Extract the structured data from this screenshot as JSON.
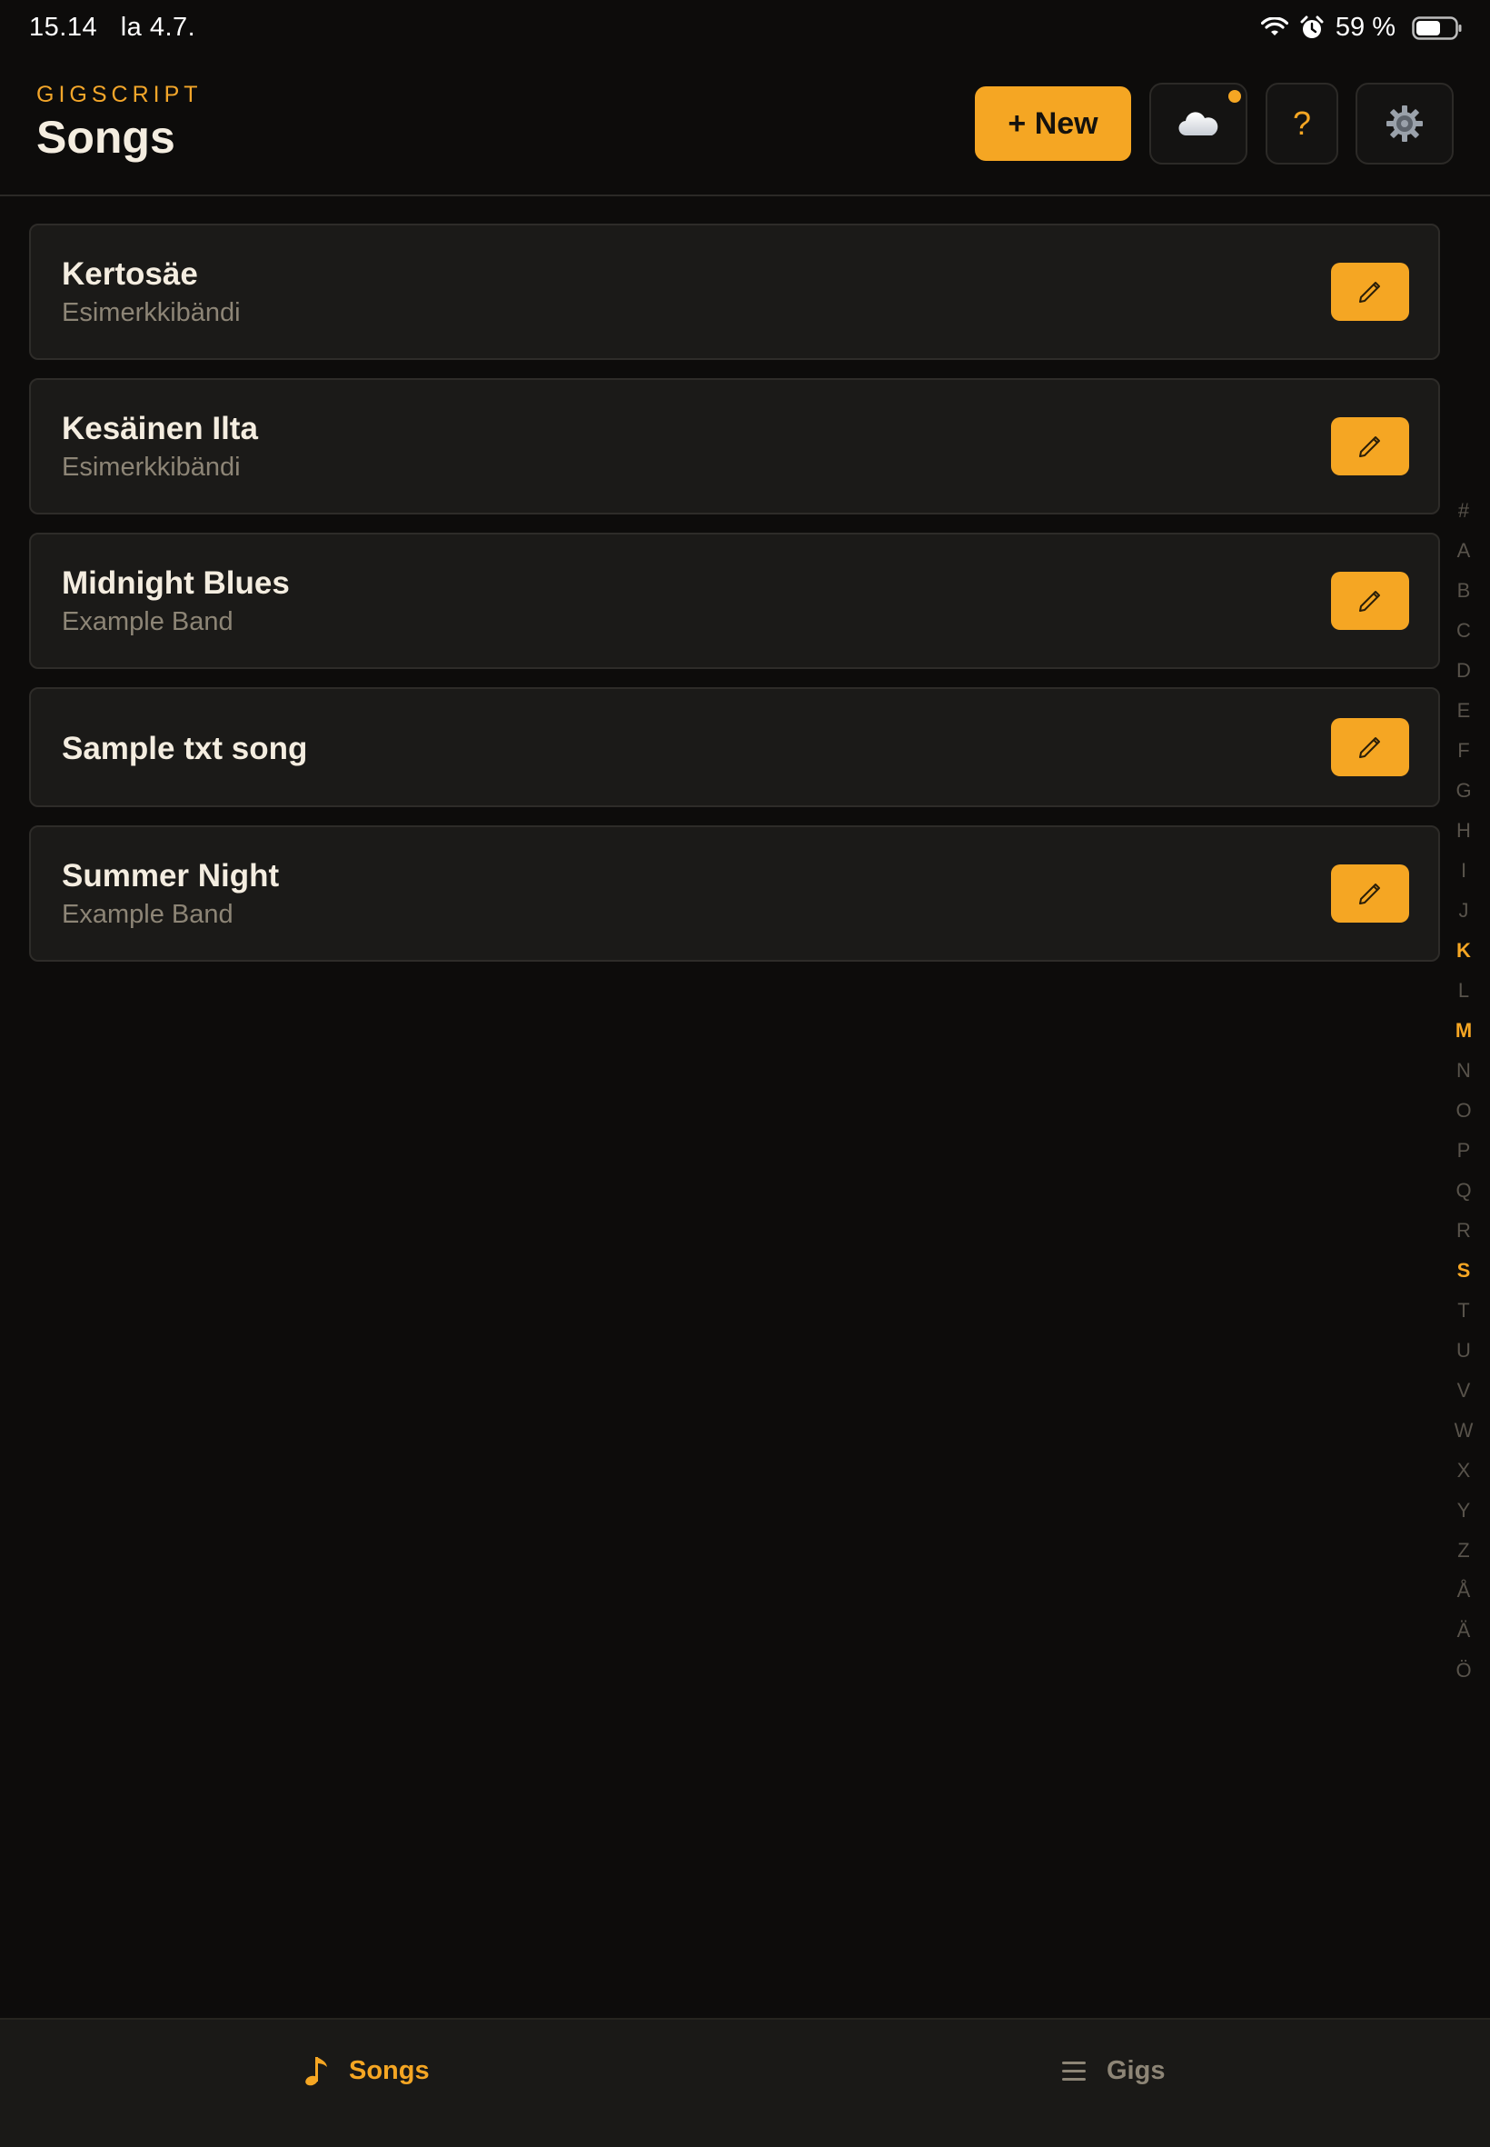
{
  "status_bar": {
    "time_date": "15.14   la 4.7.",
    "battery": "59 %"
  },
  "header": {
    "brand": "GIGSCRIPT",
    "title": "Songs",
    "new_button": "+ New",
    "help_button": "?"
  },
  "songs": [
    {
      "title": "Kertosäe",
      "artist": "Esimerkkibändi"
    },
    {
      "title": "Kesäinen Ilta",
      "artist": "Esimerkkibändi"
    },
    {
      "title": "Midnight Blues",
      "artist": "Example Band"
    },
    {
      "title": "Sample txt song",
      "artist": ""
    },
    {
      "title": "Summer Night",
      "artist": "Example Band"
    }
  ],
  "alphabet_index": [
    "#",
    "A",
    "B",
    "C",
    "D",
    "E",
    "F",
    "G",
    "H",
    "I",
    "J",
    "K",
    "L",
    "M",
    "N",
    "O",
    "P",
    "Q",
    "R",
    "S",
    "T",
    "U",
    "V",
    "W",
    "X",
    "Y",
    "Z",
    "Å",
    "Ä",
    "Ö"
  ],
  "alphabet_active": [
    "K",
    "M",
    "S"
  ],
  "tabs": {
    "songs": "Songs",
    "gigs": "Gigs"
  },
  "colors": {
    "accent": "#f5a623",
    "background": "#0d0c0b",
    "card": "#1b1a18"
  },
  "icons": {
    "cloud": "cloud-icon",
    "settings": "gear-icon",
    "edit": "pencil-icon",
    "songs_tab": "music-note-icon",
    "gigs_tab": "list-icon"
  }
}
